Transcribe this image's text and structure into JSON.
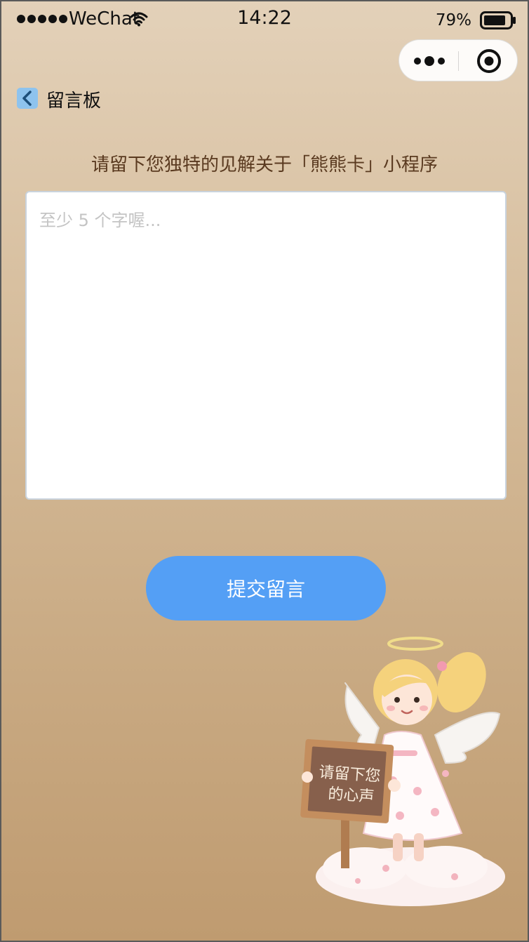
{
  "status_bar": {
    "carrier": "WeChat",
    "time": "14:22",
    "battery_percent": "79%"
  },
  "nav": {
    "title": "留言板"
  },
  "main": {
    "prompt": "请留下您独特的见解关于「熊熊卡」小程序",
    "message_input": {
      "value": "",
      "placeholder": "至少 5 个字喔..."
    },
    "submit_label": "提交留言"
  },
  "illustration": {
    "sign_line1": "请留下您",
    "sign_line2": "的心声"
  },
  "colors": {
    "accent": "#549ff5",
    "back_button": "#8ec3ee",
    "prompt_text": "#5a3a20"
  }
}
